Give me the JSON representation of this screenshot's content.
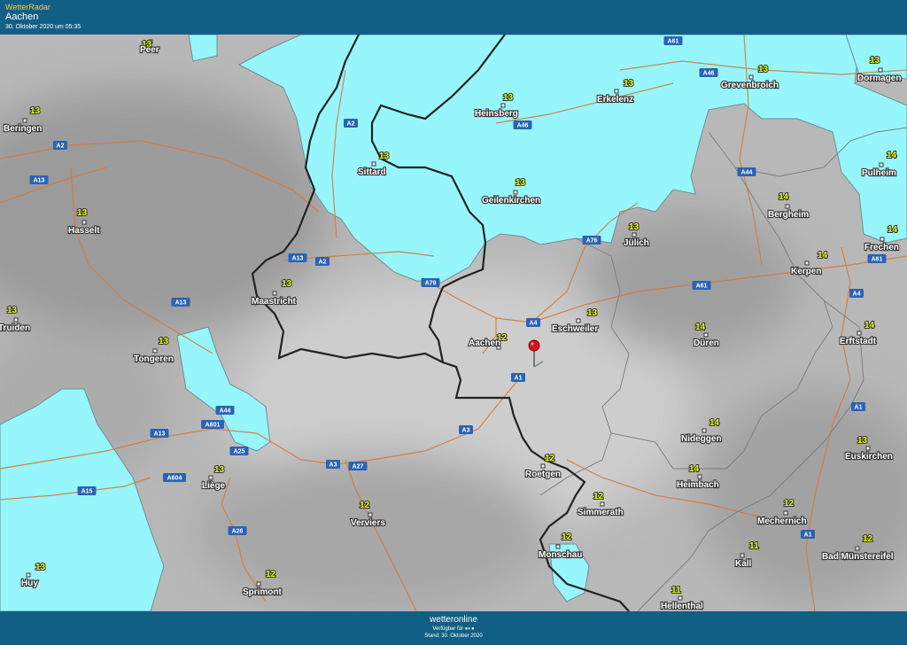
{
  "header": {
    "brand": "WetterRadar",
    "location": "Aachen",
    "timestamp": "30. Oktober 2020 um 05:35"
  },
  "footer": {
    "logo": "wetteronline",
    "provider": "Verfügbar für ●◐●",
    "status": "Stand: 30. Oktober 2020"
  },
  "colors": {
    "background": "#b9b9b9",
    "rain": "#97f6fb",
    "border": "#222222",
    "road": "#d67a3a",
    "header": "#125f86",
    "temperature": "#e9ff00"
  },
  "icons": [
    "location-pin-icon"
  ],
  "cities": [
    {
      "name": "Peer",
      "temp": "13"
    },
    {
      "name": "Beringen",
      "temp": "13"
    },
    {
      "name": "Hasselt",
      "temp": "13"
    },
    {
      "name": "Truiden",
      "temp": "13"
    },
    {
      "name": "Tongeren",
      "temp": "13"
    },
    {
      "name": "Liège",
      "temp": "13"
    },
    {
      "name": "Huy",
      "temp": "13"
    },
    {
      "name": "Sprimont",
      "temp": "12"
    },
    {
      "name": "Verviers",
      "temp": "12"
    },
    {
      "name": "Maastricht",
      "temp": "13"
    },
    {
      "name": "Sittard",
      "temp": "13"
    },
    {
      "name": "Heinsberg",
      "temp": "13"
    },
    {
      "name": "Erkelenz",
      "temp": "13"
    },
    {
      "name": "Geilenkirchen",
      "temp": "13"
    },
    {
      "name": "Grevenbroich",
      "temp": "13"
    },
    {
      "name": "Dormagen",
      "temp": "13"
    },
    {
      "name": "Pulheim",
      "temp": "14"
    },
    {
      "name": "Bergheim",
      "temp": "14"
    },
    {
      "name": "Jülich",
      "temp": "13"
    },
    {
      "name": "Frechen",
      "temp": "14"
    },
    {
      "name": "Kerpen",
      "temp": "14"
    },
    {
      "name": "Erftstadt",
      "temp": "14"
    },
    {
      "name": "Düren",
      "temp": "14"
    },
    {
      "name": "Eschweiler",
      "temp": "13"
    },
    {
      "name": "Aachen",
      "temp": "12"
    },
    {
      "name": "Nideggen",
      "temp": "14"
    },
    {
      "name": "Heimbach",
      "temp": "14"
    },
    {
      "name": "Roetgen",
      "temp": "12"
    },
    {
      "name": "Simmerath",
      "temp": "12"
    },
    {
      "name": "Monschau",
      "temp": "12"
    },
    {
      "name": "Euskirchen",
      "temp": "13"
    },
    {
      "name": "Mechernich",
      "temp": "12"
    },
    {
      "name": "Kall",
      "temp": "11"
    },
    {
      "name": "Hellenthal",
      "temp": "11"
    },
    {
      "name": "Bad Münstereifel",
      "temp": "12"
    }
  ],
  "roads": [
    "A61",
    "A46",
    "A46",
    "A2",
    "A2",
    "A13",
    "A13",
    "A2",
    "A79",
    "A76",
    "A44",
    "A61",
    "A4",
    "A4",
    "A61",
    "A1",
    "A1",
    "A1",
    "A44",
    "A601",
    "A13",
    "A3",
    "A3",
    "A25",
    "A604",
    "A15",
    "A27",
    "A3",
    "A26",
    "A13"
  ]
}
